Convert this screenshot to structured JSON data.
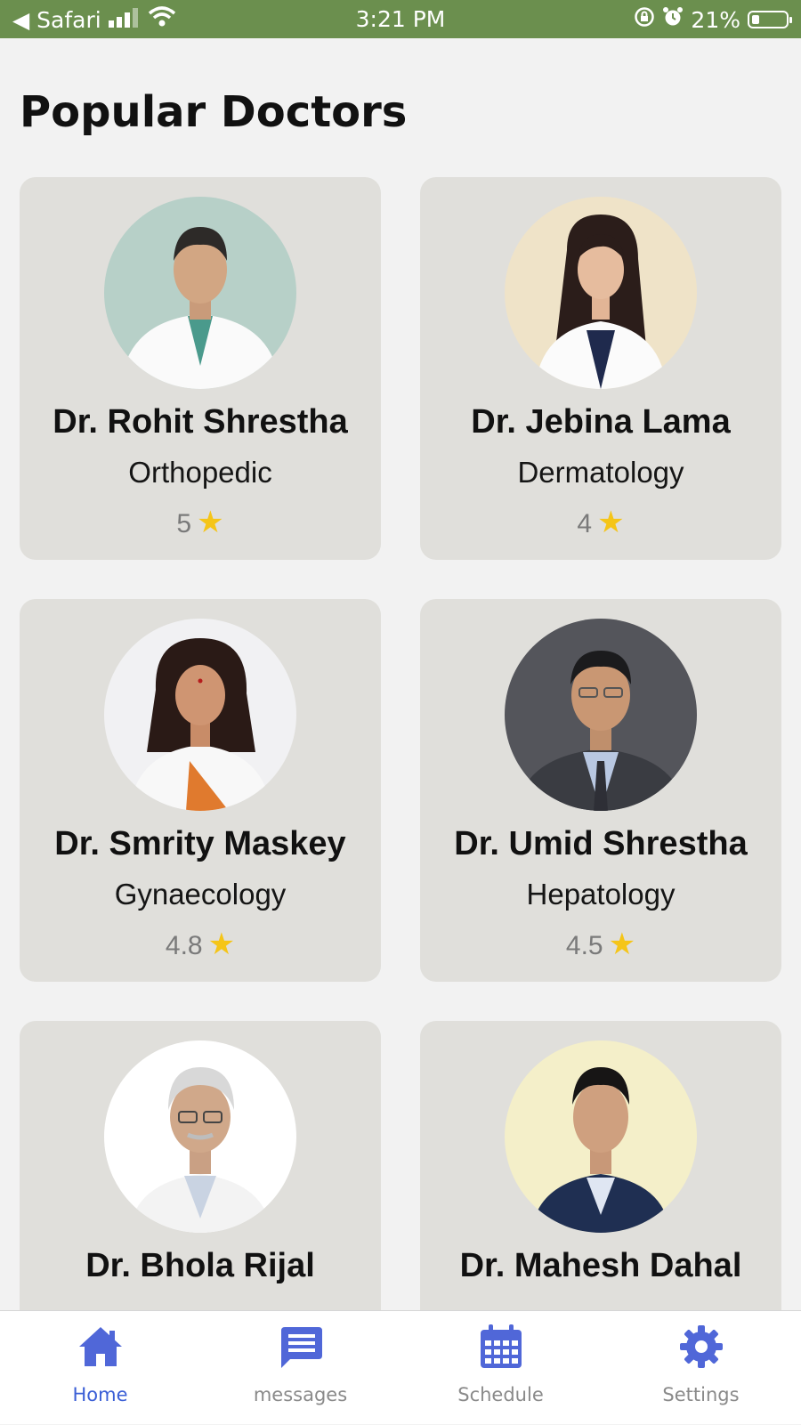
{
  "colors": {
    "status_bar_bg": "#6b8f4e",
    "card_bg": "#e0dfdb",
    "page_bg": "#f2f2f2",
    "nav_accent": "#3b5fd6",
    "nav_icon": "#5067d8",
    "nav_inactive_text": "#8a8a8a",
    "star": "#f5c518"
  },
  "status_bar": {
    "back_label": "◀ Safari",
    "time": "3:21 PM",
    "battery_percent": "21%",
    "battery_level": 0.21,
    "icons": [
      "signal-icon",
      "wifi-icon",
      "orientation-lock-icon",
      "alarm-icon",
      "battery-icon"
    ]
  },
  "page": {
    "title": "Popular Doctors"
  },
  "doctors": [
    {
      "name": "Dr. Rohit Shrestha",
      "specialty": "Orthopedic",
      "rating": "5",
      "avatar_bg": "#b7d0c8"
    },
    {
      "name": "Dr. Jebina Lama",
      "specialty": "Dermatology",
      "rating": "4",
      "avatar_bg": "#efe3c8"
    },
    {
      "name": "Dr. Smrity Maskey",
      "specialty": "Gynaecology",
      "rating": "4.8",
      "avatar_bg": "#f1f1f3"
    },
    {
      "name": "Dr. Umid Shrestha",
      "specialty": "Hepatology",
      "rating": "4.5",
      "avatar_bg": "#54555b"
    },
    {
      "name": "Dr. Bhola Rijal",
      "specialty": "",
      "rating": "",
      "avatar_bg": "#ffffff"
    },
    {
      "name": "Dr. Mahesh Dahal",
      "specialty": "",
      "rating": "",
      "avatar_bg": "#f4efc9"
    }
  ],
  "nav": {
    "items": [
      {
        "label": "Home",
        "icon": "home-icon",
        "active": true
      },
      {
        "label": "messages",
        "icon": "messages-icon",
        "active": false
      },
      {
        "label": "Schedule",
        "icon": "calendar-icon",
        "active": false
      },
      {
        "label": "Settings",
        "icon": "gear-icon",
        "active": false
      }
    ]
  }
}
